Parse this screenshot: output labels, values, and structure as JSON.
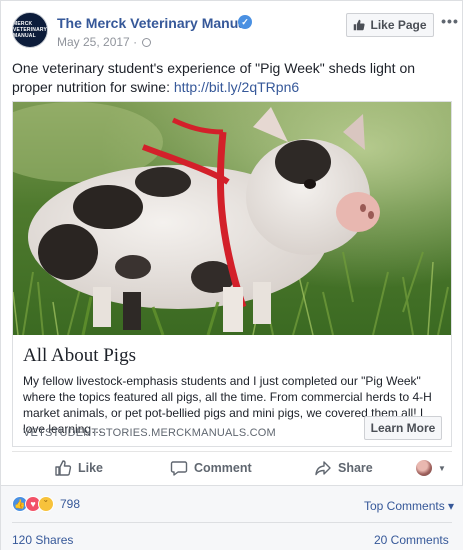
{
  "header": {
    "avatar_text": "MERCK VETERINARY MANUAL",
    "page_name": "The Merck Veterinary Manual",
    "verified_icon": "verified-check-icon",
    "date": "May 25, 2017",
    "privacy_icon": "globe-icon",
    "like_page_label": "Like Page",
    "more_label": "•••"
  },
  "caption": {
    "text": "One veterinary student's experience of \"Pig Week\" sheds light on proper nutrition for swine: ",
    "link": "http://bit.ly/2qTRpn6"
  },
  "card": {
    "image_alt": "Spotted piglet wearing a red harness standing in grass",
    "title": "All About Pigs",
    "description": "My fellow livestock-emphasis students and I just completed our \"Pig Week\" where the topics featured all pigs, all the time. From commercial herds to 4-H market animals, or pet pot-bellied pigs and mini pigs, we covered them all! I love learning…",
    "domain": "VETSTUDENTSTORIES.MERCKMANUALS.COM",
    "cta": "Learn More"
  },
  "actions": {
    "like": "Like",
    "comment": "Comment",
    "share": "Share"
  },
  "footer": {
    "reaction_count": "798",
    "top_comments": "Top Comments ▾",
    "shares": "120 Shares",
    "comments": "20 Comments"
  },
  "colors": {
    "link": "#365899",
    "muted": "#90949c",
    "like_blue": "#4a90e2",
    "love_red": "#f25268",
    "haha_yellow": "#f7c23b",
    "harness_red": "#d3202a"
  }
}
